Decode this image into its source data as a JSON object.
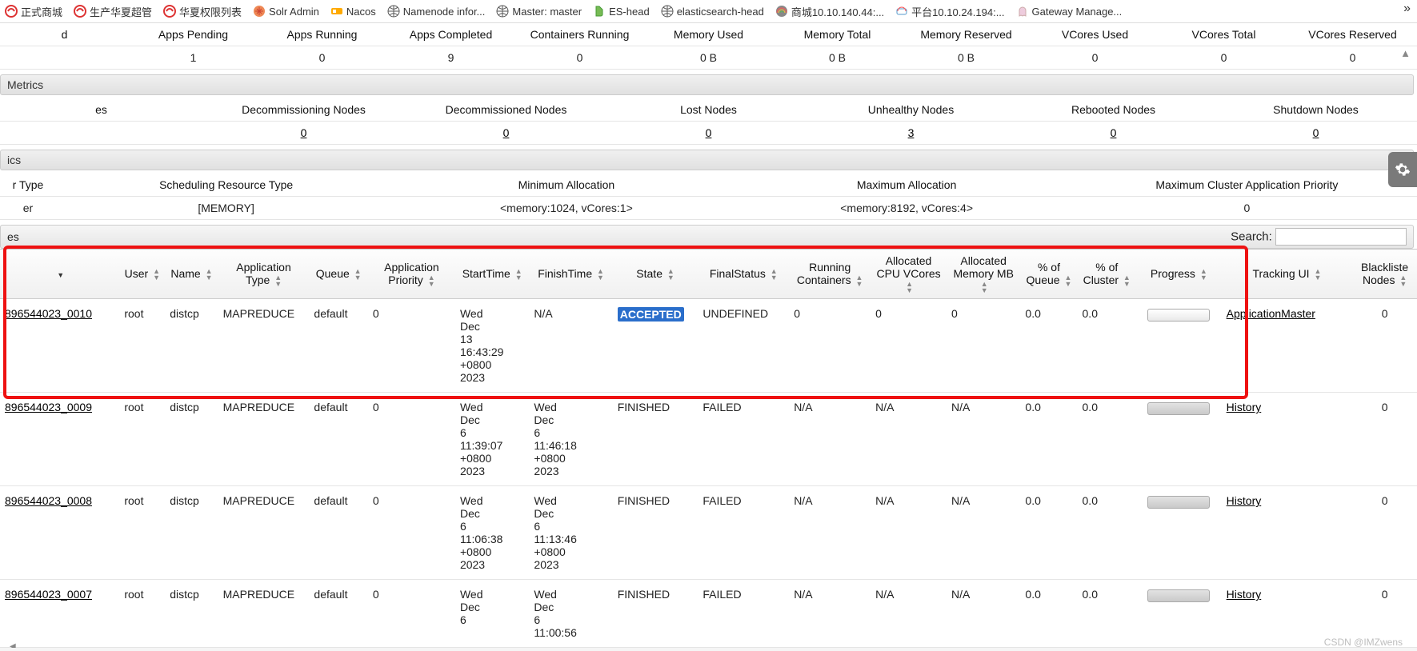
{
  "bookmarks": [
    {
      "label": "正式商城",
      "icon": "red"
    },
    {
      "label": "生产华夏超管",
      "icon": "red"
    },
    {
      "label": "华夏权限列表",
      "icon": "red"
    },
    {
      "label": "Solr Admin",
      "icon": "solr"
    },
    {
      "label": "Nacos",
      "icon": "nacos"
    },
    {
      "label": "Namenode infor...",
      "icon": "globe"
    },
    {
      "label": "Master: master",
      "icon": "globe"
    },
    {
      "label": "ES-head",
      "icon": "es"
    },
    {
      "label": "elasticsearch-head",
      "icon": "globe"
    },
    {
      "label": "商城10.10.140.44:...",
      "icon": "rainbow"
    },
    {
      "label": "平台10.10.24.194:...",
      "icon": "rainbow2"
    },
    {
      "label": "Gateway Manage...",
      "icon": "ghost"
    }
  ],
  "bookmark_more": "»",
  "scroll_hint": "▲",
  "cluster_metrics": {
    "headers": [
      "d",
      "Apps Pending",
      "Apps Running",
      "Apps Completed",
      "Containers Running",
      "Memory Used",
      "Memory Total",
      "Memory Reserved",
      "VCores Used",
      "VCores Total",
      "VCores Reserved"
    ],
    "values": [
      "",
      "1",
      "0",
      "9",
      "0",
      "0 B",
      "0 B",
      "0 B",
      "0",
      "0",
      "0"
    ]
  },
  "section_metrics": "Metrics",
  "node_metrics": {
    "headers": [
      "es",
      "Decommissioning Nodes",
      "Decommissioned Nodes",
      "Lost Nodes",
      "Unhealthy Nodes",
      "Rebooted Nodes",
      "Shutdown Nodes"
    ],
    "values": [
      "",
      "0",
      "0",
      "0",
      "3",
      "0",
      "0"
    ]
  },
  "section_ics": "ics",
  "scheduler": {
    "headers": [
      "r Type",
      "Scheduling Resource Type",
      "Minimum Allocation",
      "Maximum Allocation",
      "Maximum Cluster Application Priority"
    ],
    "values": [
      "er",
      "[MEMORY]",
      "<memory:1024, vCores:1>",
      "<memory:8192, vCores:4>",
      "0"
    ]
  },
  "apps_bar": {
    "title": "es",
    "search_label": "Search:"
  },
  "apps": {
    "headers": [
      "",
      "User",
      "Name",
      "Application Type",
      "Queue",
      "Application Priority",
      "StartTime",
      "FinishTime",
      "State",
      "FinalStatus",
      "Running Containers",
      "Allocated CPU VCores",
      "Allocated Memory MB",
      "% of Queue",
      "% of Cluster",
      "Progress",
      "Tracking UI",
      "Blackliste Nodes"
    ],
    "rows": [
      {
        "id": "896544023_0010",
        "user": "root",
        "name": "distcp",
        "type": "MAPREDUCE",
        "queue": "default",
        "prio": "0",
        "start": "Wed Dec 13 16:43:29 +0800 2023",
        "finish": "N/A",
        "state": "ACCEPTED",
        "final": "UNDEFINED",
        "rc": "0",
        "cpu": "0",
        "mem": "0",
        "q": "0.0",
        "c": "0.0",
        "progress": "empty",
        "track": "ApplicationMaster",
        "bl": "0"
      },
      {
        "id": "896544023_0009",
        "user": "root",
        "name": "distcp",
        "type": "MAPREDUCE",
        "queue": "default",
        "prio": "0",
        "start": "Wed Dec 6 11:39:07 +0800 2023",
        "finish": "Wed Dec 6 11:46:18 +0800 2023",
        "state": "FINISHED",
        "final": "FAILED",
        "rc": "N/A",
        "cpu": "N/A",
        "mem": "N/A",
        "q": "0.0",
        "c": "0.0",
        "progress": "full",
        "track": "History",
        "bl": "0"
      },
      {
        "id": "896544023_0008",
        "user": "root",
        "name": "distcp",
        "type": "MAPREDUCE",
        "queue": "default",
        "prio": "0",
        "start": "Wed Dec 6 11:06:38 +0800 2023",
        "finish": "Wed Dec 6 11:13:46 +0800 2023",
        "state": "FINISHED",
        "final": "FAILED",
        "rc": "N/A",
        "cpu": "N/A",
        "mem": "N/A",
        "q": "0.0",
        "c": "0.0",
        "progress": "full",
        "track": "History",
        "bl": "0"
      },
      {
        "id": "896544023_0007",
        "user": "root",
        "name": "distcp",
        "type": "MAPREDUCE",
        "queue": "default",
        "prio": "0",
        "start": "Wed Dec 6",
        "finish": "Wed Dec 6 11:00:56",
        "state": "FINISHED",
        "final": "FAILED",
        "rc": "N/A",
        "cpu": "N/A",
        "mem": "N/A",
        "q": "0.0",
        "c": "0.0",
        "progress": "full",
        "track": "History",
        "bl": "0"
      }
    ]
  },
  "footer": "CSDN @IMZwens"
}
